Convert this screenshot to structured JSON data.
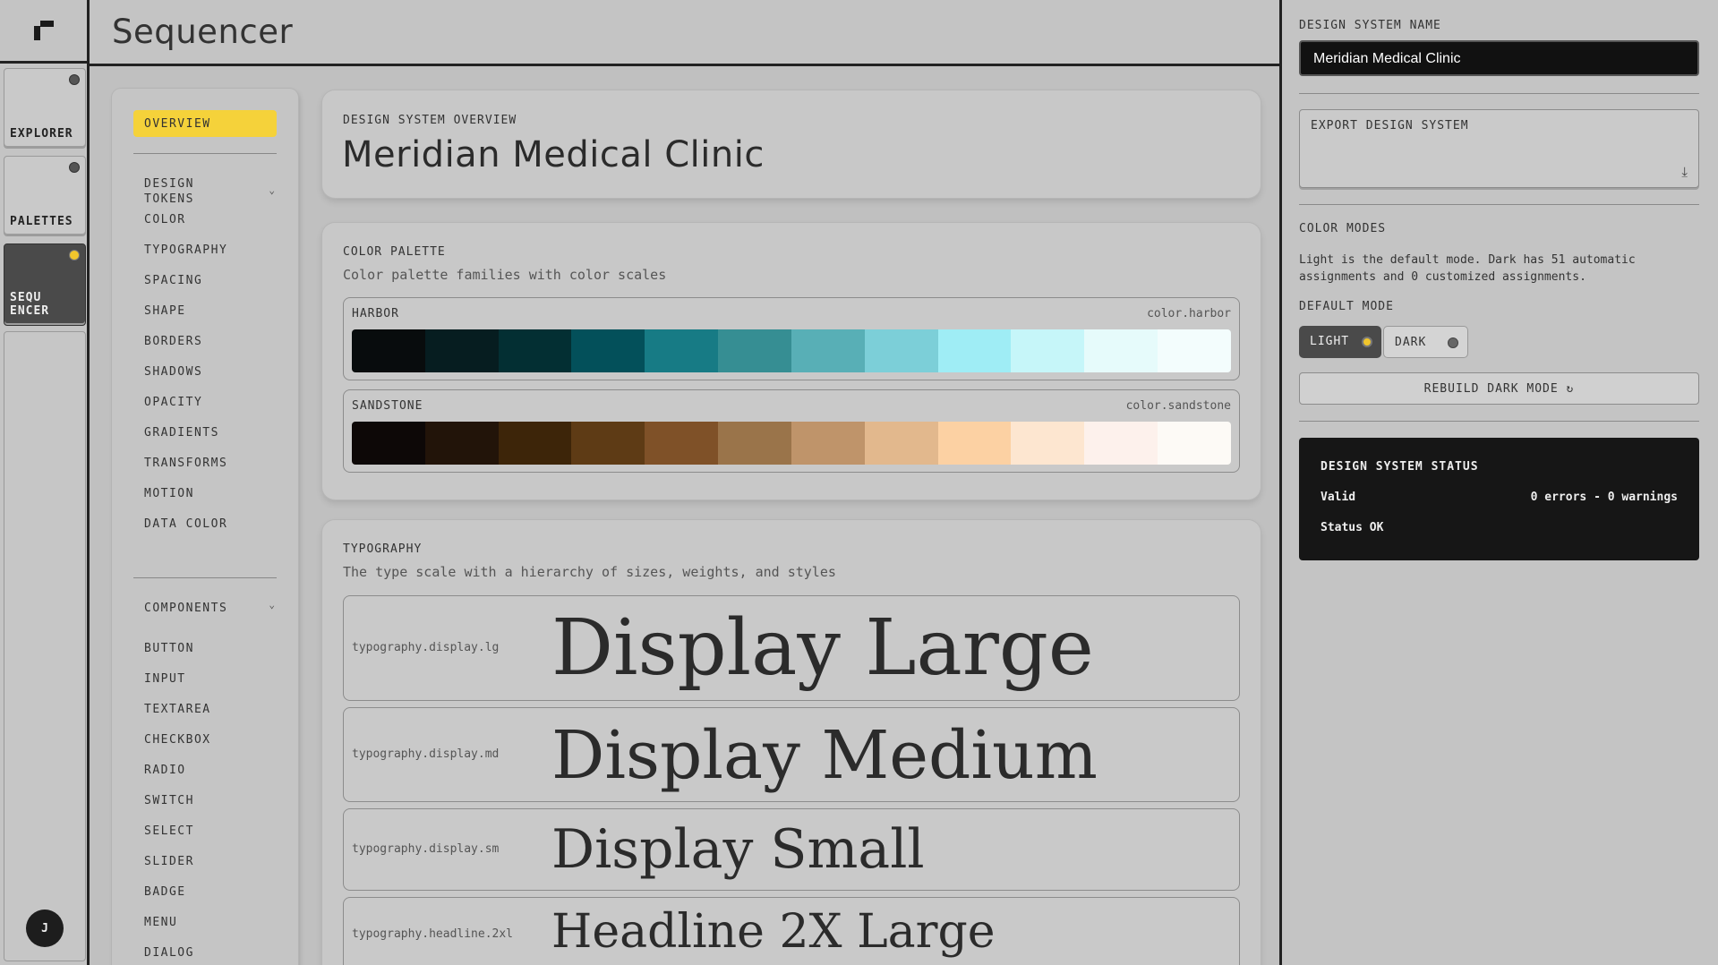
{
  "rail": {
    "items": [
      {
        "label": "EXPLORER"
      },
      {
        "label": "PALETTES"
      },
      {
        "label": "SEQU ENCER"
      }
    ],
    "avatar": "J"
  },
  "header": {
    "title": "Sequencer"
  },
  "nav": {
    "overview": "OVERVIEW",
    "design_tokens": "DESIGN TOKENS",
    "token_items": [
      "COLOR",
      "TYPOGRAPHY",
      "SPACING",
      "SHAPE",
      "BORDERS",
      "SHADOWS",
      "OPACITY",
      "GRADIENTS",
      "TRANSFORMS",
      "MOTION",
      "DATA COLOR"
    ],
    "components": "COMPONENTS",
    "component_items": [
      "BUTTON",
      "INPUT",
      "TEXTAREA",
      "CHECKBOX",
      "RADIO",
      "SWITCH",
      "SELECT",
      "SLIDER",
      "BADGE",
      "MENU",
      "DIALOG"
    ]
  },
  "overview": {
    "eyebrow": "DESIGN SYSTEM OVERVIEW",
    "title": "Meridian Medical Clinic"
  },
  "color_palette": {
    "eyebrow": "COLOR PALETTE",
    "subtitle": "Color palette families with color scales",
    "palettes": [
      {
        "name": "HARBOR",
        "token": "color.harbor",
        "colors": [
          "#080c0d",
          "#061d20",
          "#032f33",
          "#03505a",
          "#177b85",
          "#368e93",
          "#58afb6",
          "#7ccfd8",
          "#9fedf5",
          "#c6f6f9",
          "#e6fbfb",
          "#f3fdfd"
        ]
      },
      {
        "name": "SANDSTONE",
        "token": "color.sandstone",
        "colors": [
          "#0d0807",
          "#221409",
          "#3d2509",
          "#5e3b15",
          "#7f5128",
          "#9a744a",
          "#bf946a",
          "#e2b88d",
          "#fcd1a3",
          "#fde6d0",
          "#fdf1ec",
          "#fdfaf6"
        ]
      }
    ]
  },
  "typography": {
    "eyebrow": "TYPOGRAPHY",
    "subtitle": "The type scale with a hierarchy of sizes, weights, and styles",
    "rows": [
      {
        "token": "typography.display.lg",
        "sample": "Display Large"
      },
      {
        "token": "typography.display.md",
        "sample": "Display Medium"
      },
      {
        "token": "typography.display.sm",
        "sample": "Display Small"
      },
      {
        "token": "typography.headline.2xl",
        "sample": "Headline 2X Large"
      }
    ]
  },
  "right": {
    "name_label": "DESIGN SYSTEM NAME",
    "name_value": "Meridian Medical Clinic",
    "export_label": "EXPORT DESIGN SYSTEM",
    "color_modes_label": "COLOR MODES",
    "color_modes_text": "Light is the default mode. Dark has 51 automatic assignments and 0 customized assignments.",
    "default_mode_label": "DEFAULT MODE",
    "light_label": "LIGHT",
    "dark_label": "DARK",
    "rebuild_label": "REBUILD DARK MODE",
    "status_title": "DESIGN SYSTEM STATUS",
    "status_valid": "Valid",
    "status_counts": "0 errors - 0 warnings",
    "status_ok": "Status OK"
  }
}
